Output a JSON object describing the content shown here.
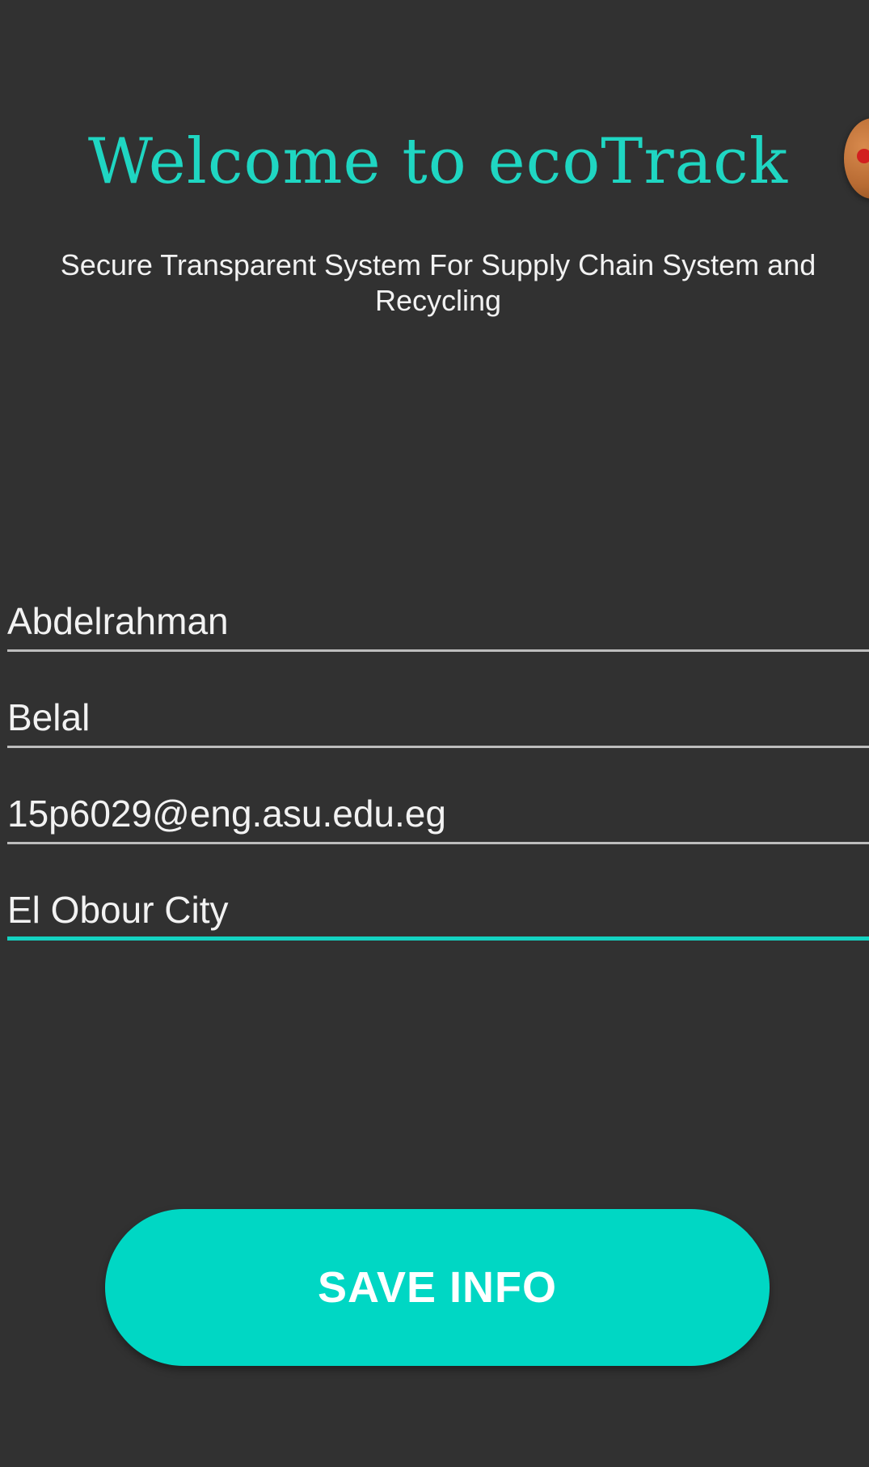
{
  "header": {
    "title": "Welcome to ecoTrack",
    "subtitle": "Secure Transparent System For Supply Chain System and Recycling"
  },
  "overlay": {
    "bubble_icon": "floating-bubble-icon",
    "bubble_color": "#b86b33",
    "bubble_dot_color": "#d21f1f"
  },
  "form": {
    "first_name_value": "Abdelrahman",
    "last_name_value": "Belal",
    "email_value": "15p6029@eng.asu.edu.eg",
    "city_value": "El Obour City"
  },
  "actions": {
    "save_label": "SAVE INFO"
  },
  "theme": {
    "background": "#313131",
    "accent": "#00d7c4",
    "title_color": "#1fd6c2",
    "text_color": "#f2f2f2"
  }
}
